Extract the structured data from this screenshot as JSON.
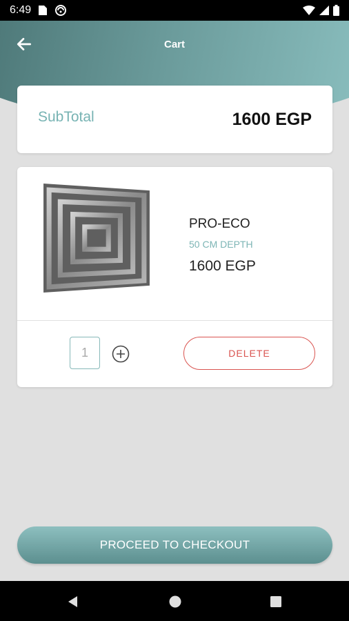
{
  "status_bar": {
    "time": "6:49",
    "icons": [
      "sd-card-icon",
      "sync-icon",
      "wifi-icon",
      "signal-icon",
      "battery-icon"
    ]
  },
  "header": {
    "title": "Cart",
    "back_icon": "arrow-left-icon"
  },
  "subtotal": {
    "label": "SubTotal",
    "value": "1600 EGP"
  },
  "cart_item": {
    "name": "PRO-ECO",
    "variant": "50 CM DEPTH",
    "price": "1600 EGP",
    "quantity": "1",
    "delete_label": "DELETE",
    "image_icon": "grille-product-icon"
  },
  "checkout": {
    "label": "PROCEED TO CHECKOUT"
  },
  "nav": {
    "icons": [
      "back-triangle-icon",
      "home-circle-icon",
      "recents-square-icon"
    ]
  },
  "colors": {
    "accent": "#77b3b3",
    "delete": "#d9534f",
    "header_start": "#4f7a7a",
    "header_end": "#88bcbc"
  }
}
